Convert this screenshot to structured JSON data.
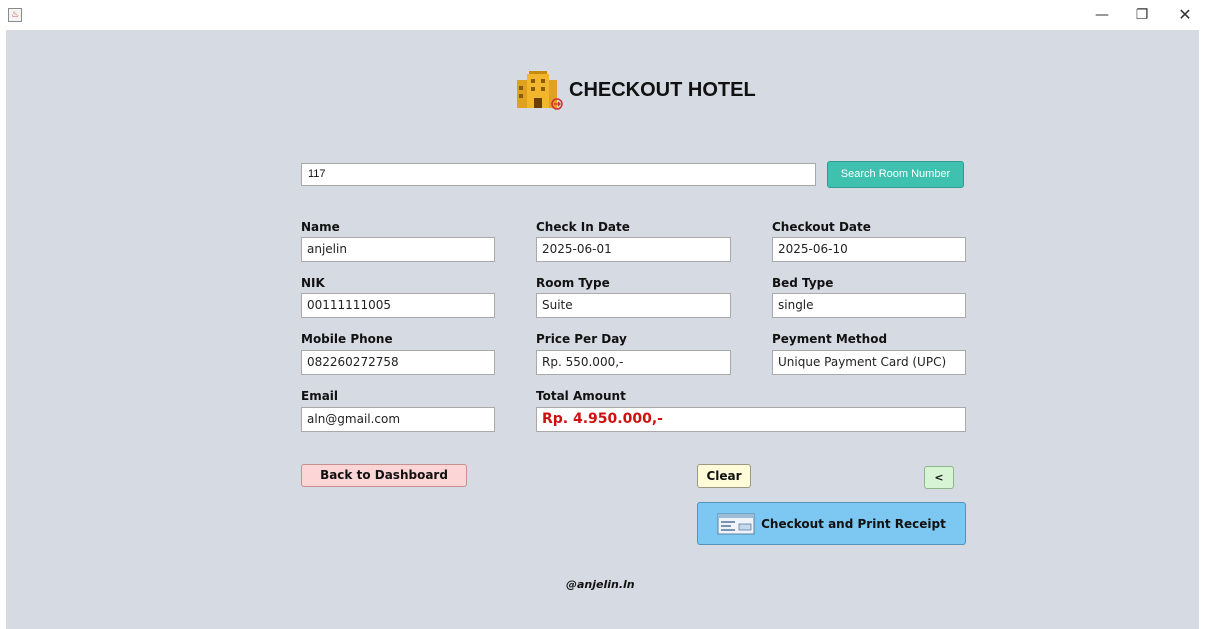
{
  "window": {
    "minimize_glyph": "—",
    "maximize_glyph": "❐",
    "close_glyph": "✕"
  },
  "header": {
    "title": "CHECKOUT HOTEL",
    "icon": "hotel-checkout-icon"
  },
  "search": {
    "value": "117",
    "button_label": "Search Room Number"
  },
  "form": {
    "name_label": "Name",
    "name_value": "anjelin",
    "nik_label": "NIK",
    "nik_value": "00111111005",
    "mobile_label": "Mobile Phone",
    "mobile_value": "082260272758",
    "email_label": "Email",
    "email_value": "aln@gmail.com",
    "checkin_label": "Check In Date",
    "checkin_value": "2025-06-01",
    "roomtype_label": "Room Type",
    "roomtype_value": "Suite",
    "price_label": "Price Per Day",
    "price_value": "Rp. 550.000,-",
    "total_label": "Total Amount",
    "total_value": "Rp. 4.950.000,-",
    "checkout_label": "Checkout Date",
    "checkout_value": "2025-06-10",
    "bedtype_label": "Bed Type",
    "bedtype_value": "single",
    "payment_label": "Peyment Method",
    "payment_value": "Unique Payment Card (UPC)"
  },
  "buttons": {
    "back_dashboard": "Back to Dashboard",
    "clear": "Clear",
    "back_arrow": "<",
    "checkout_print": "Checkout and Print Receipt"
  },
  "footer": {
    "credit": "@anjelin.ln"
  },
  "colors": {
    "background": "#d6dae3",
    "search_button": "#3fc1b0",
    "total_amount_text": "#d01010",
    "back_button": "#fcd6d6",
    "clear_button": "#fdfbd8",
    "arrow_button": "#d7f5d4",
    "checkout_button": "#7cc8f2"
  }
}
